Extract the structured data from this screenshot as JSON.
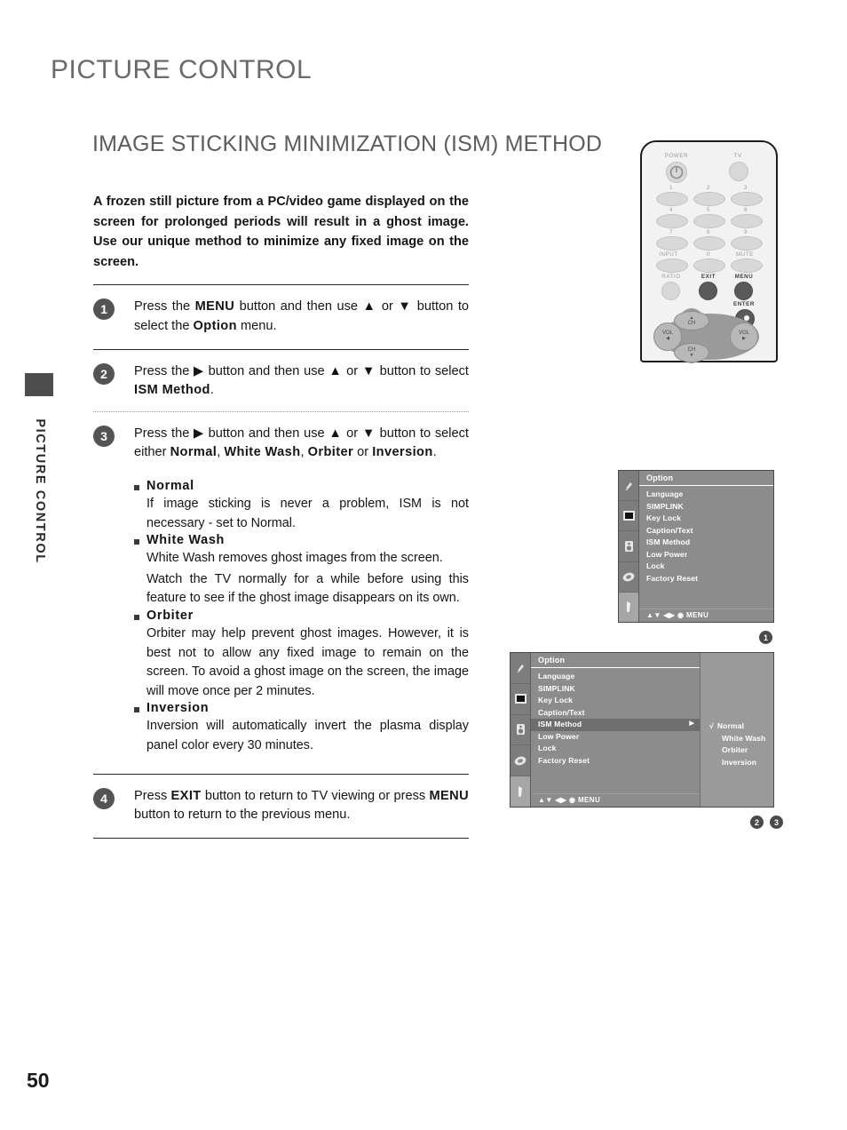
{
  "page": {
    "chapter_title": "PICTURE CONTROL",
    "section_title": "IMAGE STICKING MINIMIZATION (ISM) METHOD",
    "side_tab_label": "PICTURE CONTROL",
    "page_number": "50"
  },
  "intro": "A frozen still picture from a PC/video game displayed on the screen for prolonged periods will result in a ghost image. Use our unique method to minimize any fixed image on the screen.",
  "steps": [
    {
      "num": "1",
      "parts": [
        {
          "t": "Press the ",
          "b": false
        },
        {
          "t": "MENU",
          "b": true
        },
        {
          "t": " button and then use ",
          "b": false
        },
        {
          "t": "▲",
          "b": false
        },
        {
          "t": " or ",
          "b": false
        },
        {
          "t": "▼",
          "b": false
        },
        {
          "t": " button to select the ",
          "b": false
        },
        {
          "t": "Option",
          "b": true
        },
        {
          "t": " menu.",
          "b": false
        }
      ]
    },
    {
      "num": "2",
      "parts": [
        {
          "t": "Press the ",
          "b": false
        },
        {
          "t": "▶",
          "b": false
        },
        {
          "t": " button and then use ",
          "b": false
        },
        {
          "t": "▲",
          "b": false
        },
        {
          "t": " or ",
          "b": false
        },
        {
          "t": "▼",
          "b": false
        },
        {
          "t": " button to select ",
          "b": false
        },
        {
          "t": "ISM Method",
          "b": true
        },
        {
          "t": ".",
          "b": false
        }
      ]
    },
    {
      "num": "3",
      "parts": [
        {
          "t": "Press the ",
          "b": false
        },
        {
          "t": "▶",
          "b": false
        },
        {
          "t": " button and then use ",
          "b": false
        },
        {
          "t": "▲",
          "b": false
        },
        {
          "t": " or ",
          "b": false
        },
        {
          "t": "▼",
          "b": false
        },
        {
          "t": " button to select either ",
          "b": false
        },
        {
          "t": "Normal",
          "b": true
        },
        {
          "t": ", ",
          "b": false
        },
        {
          "t": "White Wash",
          "b": true
        },
        {
          "t": ", ",
          "b": false
        },
        {
          "t": "Orbiter",
          "b": true
        },
        {
          "t": " or ",
          "b": false
        },
        {
          "t": "Inversion",
          "b": true
        },
        {
          "t": ".",
          "b": false
        }
      ]
    },
    {
      "num": "4",
      "parts": [
        {
          "t": "Press ",
          "b": false
        },
        {
          "t": "EXIT",
          "b": true
        },
        {
          "t": " button to return to TV viewing or press ",
          "b": false
        },
        {
          "t": "MENU",
          "b": true
        },
        {
          "t": " button to return to the previous menu.",
          "b": false
        }
      ]
    }
  ],
  "bullets": [
    {
      "head": "Normal",
      "paragraphs": [
        "If image sticking is never a problem, ISM is not necessary - set to Normal."
      ]
    },
    {
      "head": "White Wash",
      "paragraphs": [
        "White Wash removes ghost images from the screen.",
        "Watch the TV normally for a while before using this feature to see if the ghost image disappears on its own."
      ]
    },
    {
      "head": "Orbiter",
      "paragraphs": [
        "Orbiter may help prevent ghost images. However, it is best not to allow any fixed image to remain on the screen. To avoid a ghost image on the screen, the image will move once per 2 minutes."
      ]
    },
    {
      "head": "Inversion",
      "paragraphs": [
        "Inversion will automatically invert the plasma display panel color every 30 minutes."
      ]
    }
  ],
  "remote": {
    "labels": {
      "power": "POWER",
      "tv": "TV",
      "k1": "1",
      "k2": "2",
      "k3": "3",
      "k4": "4",
      "k5": "5",
      "k6": "6",
      "k7": "7",
      "k8": "8",
      "k9": "9",
      "input": "INPUT",
      "k0": "0",
      "mute": "MUTE",
      "ratio": "RATIO",
      "exit": "EXIT",
      "menu": "MENU",
      "enter": "ENTER",
      "vol_left": "VOL",
      "vol_right": "VOL",
      "ch_up": "CH",
      "ch_down": "CH"
    }
  },
  "osd1": {
    "header": "Option",
    "items": [
      "Language",
      "SIMPLINK",
      "Key Lock",
      "Caption/Text",
      "ISM Method",
      "Low Power",
      "Lock",
      "Factory Reset"
    ],
    "footer": "▲▼  ◀▶   ◉   MENU",
    "marker": "1"
  },
  "osd2": {
    "header": "Option",
    "items": [
      "Language",
      "SIMPLINK",
      "Key Lock",
      "Caption/Text",
      "ISM Method",
      "Low Power",
      "Lock",
      "Factory Reset"
    ],
    "selected_item": "ISM Method",
    "selected_arrow": "▶",
    "submenu": [
      {
        "label": "Normal",
        "checked": true,
        "check": "√"
      },
      {
        "label": "White Wash",
        "checked": false,
        "check": ""
      },
      {
        "label": "Orbiter",
        "checked": false,
        "check": ""
      },
      {
        "label": "Inversion",
        "checked": false,
        "check": ""
      }
    ],
    "footer": "▲▼  ◀▶   ◉   MENU",
    "markers": [
      "2",
      "3"
    ]
  },
  "colors": {
    "chapter_gray": "#6a6a6a",
    "osd_bg": "#8c8c8c",
    "osd_selected": "#6e6e6e",
    "step_circle": "#545454"
  }
}
